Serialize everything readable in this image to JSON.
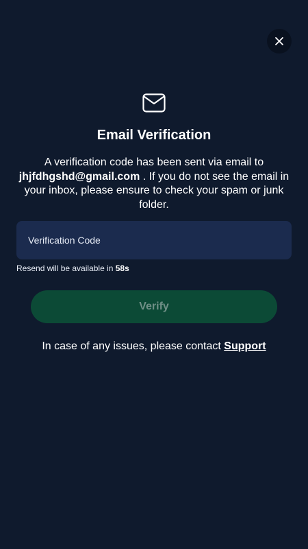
{
  "dialog": {
    "title": "Email Verification",
    "message_before": "A verification code has been sent via email to ",
    "email": "jhjfdhgshd@gmail.com",
    "message_after": " . If you do not see the email in your inbox, please ensure to check your spam or junk folder."
  },
  "form": {
    "code_placeholder": "Verification Code",
    "code_value": "",
    "resend_prefix": "Resend will be available in ",
    "resend_countdown": "58s",
    "verify_label": "Verify"
  },
  "footer": {
    "contact_text": "In case of any issues, please contact ",
    "support_link": "Support"
  },
  "icons": {
    "close": "close-icon",
    "mail": "mail-icon"
  },
  "colors": {
    "background": "#0f1a2d",
    "input_bg": "#1b2b4e",
    "verify_bg": "#0c4a36",
    "verify_text": "#6f8f86"
  }
}
